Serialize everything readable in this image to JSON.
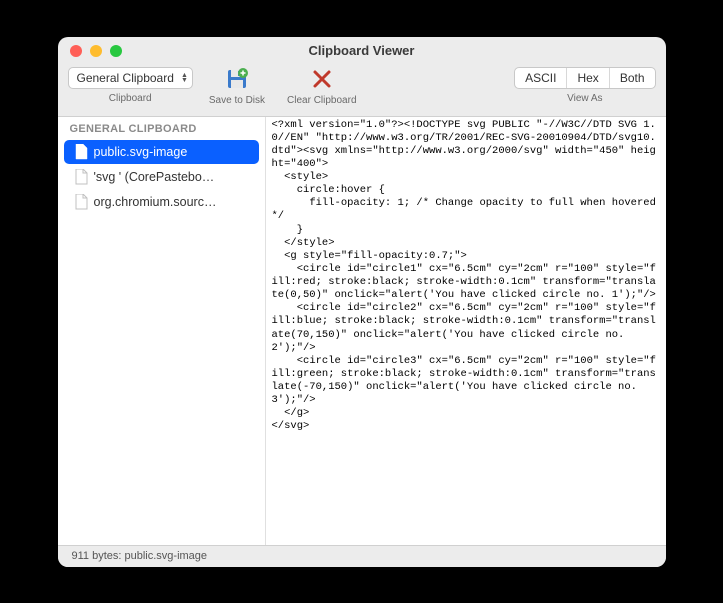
{
  "window": {
    "title": "Clipboard Viewer"
  },
  "toolbar": {
    "clipboard_select": "General Clipboard",
    "clipboard_label": "Clipboard",
    "save_label": "Save to Disk",
    "clear_label": "Clear Clipboard",
    "viewas_label": "View As",
    "seg": {
      "ascii": "ASCII",
      "hex": "Hex",
      "both": "Both"
    }
  },
  "sidebar": {
    "header": "GENERAL CLIPBOARD",
    "items": [
      {
        "label": "public.svg-image",
        "selected": true
      },
      {
        "label": "'svg ' (CorePastebo…",
        "selected": false
      },
      {
        "label": "org.chromium.sourc…",
        "selected": false
      }
    ]
  },
  "content": {
    "text": "<?xml version=\"1.0\"?><!DOCTYPE svg PUBLIC \"-//W3C//DTD SVG 1.0//EN\" \"http://www.w3.org/TR/2001/REC-SVG-20010904/DTD/svg10.dtd\"><svg xmlns=\"http://www.w3.org/2000/svg\" width=\"450\" height=\"400\">\n  <style>\n    circle:hover {\n      fill-opacity: 1; /* Change opacity to full when hovered */\n    }\n  </style>\n  <g style=\"fill-opacity:0.7;\">\n    <circle id=\"circle1\" cx=\"6.5cm\" cy=\"2cm\" r=\"100\" style=\"fill:red; stroke:black; stroke-width:0.1cm\" transform=\"translate(0,50)\" onclick=\"alert('You have clicked circle no. 1');\"/>\n    <circle id=\"circle2\" cx=\"6.5cm\" cy=\"2cm\" r=\"100\" style=\"fill:blue; stroke:black; stroke-width:0.1cm\" transform=\"translate(70,150)\" onclick=\"alert('You have clicked circle no. 2');\"/>\n    <circle id=\"circle3\" cx=\"6.5cm\" cy=\"2cm\" r=\"100\" style=\"fill:green; stroke:black; stroke-width:0.1cm\" transform=\"translate(-70,150)\" onclick=\"alert('You have clicked circle no. 3');\"/>\n  </g>\n</svg>"
  },
  "statusbar": {
    "text": "911 bytes: public.svg-image"
  }
}
